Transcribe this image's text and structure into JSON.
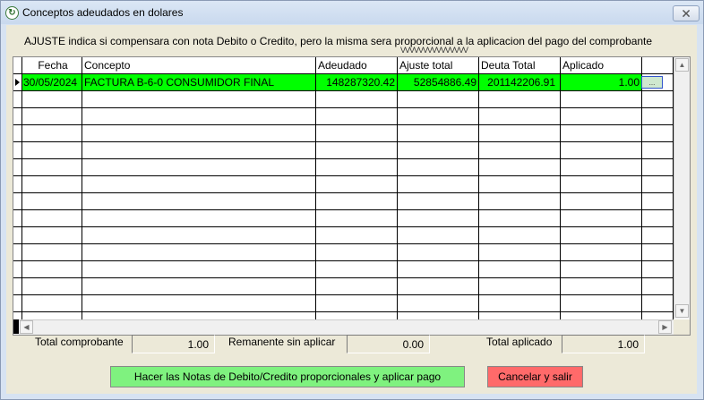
{
  "window": {
    "title": "Conceptos adeudados en dolares",
    "close_label": "🗙"
  },
  "info_text": "AJUSTE indica si compensara con nota Debito o Credito, pero la misma sera proporcional a la aplicacion del pago del comprobante",
  "grid": {
    "columns": [
      "Fecha",
      "Concepto",
      "Adeudado",
      "Ajuste total",
      "Deuta Total",
      "Aplicado",
      ""
    ],
    "rows": [
      {
        "fecha": "30/05/2024",
        "concepto": "FACTURA B-6-0 CONSUMIDOR FINAL",
        "adeudado": "148287320.42",
        "ajuste_total": "52854886.49",
        "deuda_total": "201142206.91",
        "aplicado": "1.00",
        "action": "..."
      }
    ],
    "selected_color": "#00ff00"
  },
  "totals": {
    "total_comprobante_label": "Total comprobante",
    "total_comprobante_value": "1.00",
    "remanente_label": "Remanente sin aplicar",
    "remanente_value": "0.00",
    "total_aplicado_label": "Total aplicado",
    "total_aplicado_value": "1.00"
  },
  "buttons": {
    "apply_label": "Hacer las Notas de Debito/Credito proporcionales y aplicar pago",
    "cancel_label": "Cancelar y salir"
  }
}
